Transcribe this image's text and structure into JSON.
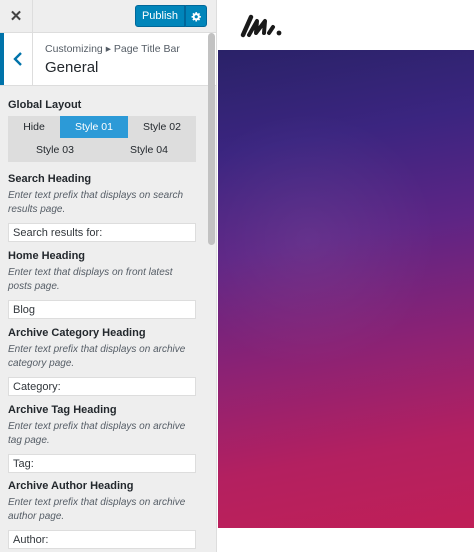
{
  "topbar": {
    "close_icon": "close-icon",
    "publish_label": "Publish",
    "gear_icon": "gear-icon"
  },
  "section": {
    "back_icon": "chevron-left-icon",
    "breadcrumb": "Customizing ▸ Page Title Bar",
    "title": "General"
  },
  "global_layout": {
    "title": "Global Layout",
    "options": [
      "Hide",
      "Style 01",
      "Style 02",
      "Style 03",
      "Style 04"
    ],
    "selected": "Style 01"
  },
  "controls": [
    {
      "title": "Search Heading",
      "description": "Enter text prefix that displays on search results page.",
      "value": "Search results for:"
    },
    {
      "title": "Home Heading",
      "description": "Enter text that displays on front latest posts page.",
      "value": "Blog"
    },
    {
      "title": "Archive Category Heading",
      "description": "Enter text prefix that displays on archive category page.",
      "value": "Category:"
    },
    {
      "title": "Archive Tag Heading",
      "description": "Enter text prefix that displays on archive tag page.",
      "value": "Tag:"
    },
    {
      "title": "Archive Author Heading",
      "description": "Enter text prefix that displays on archive author page.",
      "value": "Author:"
    }
  ],
  "preview": {
    "logo_icon": "site-logo-icon",
    "colors": {
      "hero_top": "#2a2268",
      "hero_mid": "#5d2585",
      "hero_bottom": "#c01f57",
      "accent": "#0085ba",
      "segment_active": "#2c9ad7"
    }
  }
}
